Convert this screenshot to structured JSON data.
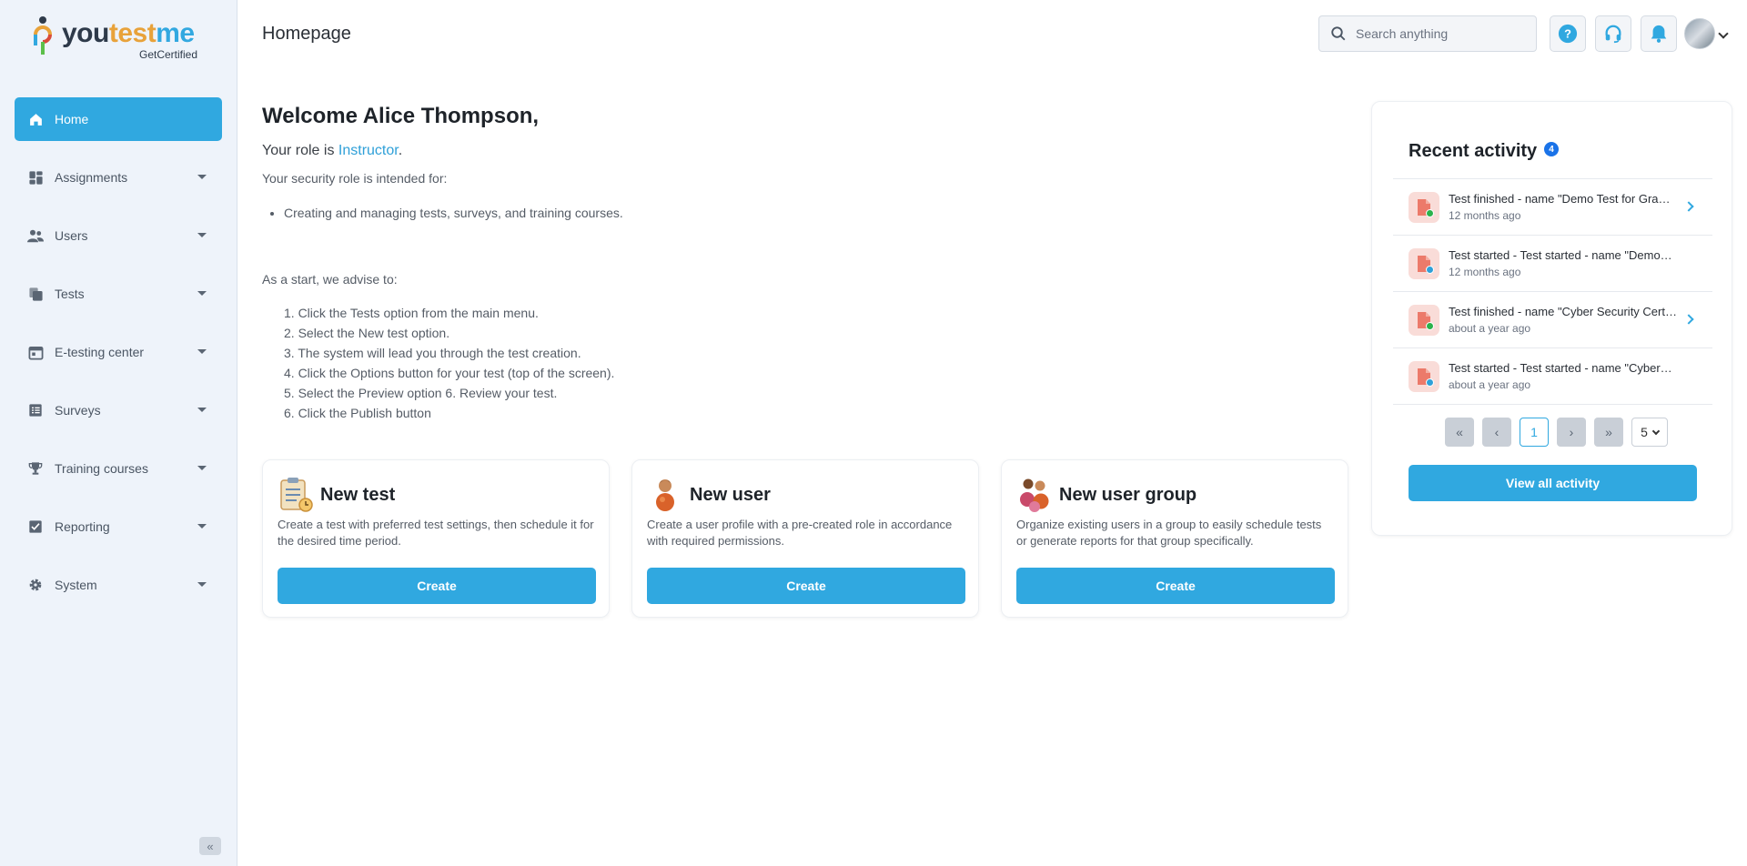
{
  "logo": {
    "brand": "youtestme",
    "tagline": "GetCertified"
  },
  "sidebar": {
    "items": [
      {
        "label": "Home",
        "icon": "home-icon",
        "active": true
      },
      {
        "label": "Assignments",
        "icon": "dashboard-icon"
      },
      {
        "label": "Users",
        "icon": "users-icon"
      },
      {
        "label": "Tests",
        "icon": "tests-icon"
      },
      {
        "label": "E-testing center",
        "icon": "calendar-icon"
      },
      {
        "label": "Surveys",
        "icon": "list-icon"
      },
      {
        "label": "Training courses",
        "icon": "trophy-icon"
      },
      {
        "label": "Reporting",
        "icon": "checkbox-icon"
      },
      {
        "label": "System",
        "icon": "gear-icon"
      }
    ],
    "collapse_label": "«"
  },
  "header": {
    "title": "Homepage",
    "search_placeholder": "Search anything"
  },
  "welcome": {
    "greeting": "Welcome Alice Thompson,",
    "role_prefix": "Your role is ",
    "role_name": "Instructor",
    "role_suffix": ".",
    "security_intro": "Your security role is intended for:",
    "security_items": [
      "Creating and managing tests, surveys, and training courses."
    ],
    "advise_intro": "As a start, we advise to:",
    "steps": [
      "1. Click the Tests option from the main menu.",
      "2. Select the New test option.",
      "3. The system will lead you through the test creation.",
      "4. Click the Options button for your test (top of the screen).",
      "5. Select the Preview option 6. Review your test.",
      "6. Click the Publish button"
    ]
  },
  "cards": [
    {
      "title": "New test",
      "description": "Create a test with preferred test settings, then schedule it for the desired time period.",
      "button": "Create"
    },
    {
      "title": "New user",
      "description": "Create a user profile with a pre-created role in accordance with required permissions.",
      "button": "Create"
    },
    {
      "title": "New user group",
      "description": "Organize existing users in a group to easily schedule tests or generate reports for that group specifically.",
      "button": "Create"
    }
  ],
  "recent_activity": {
    "title": "Recent activity",
    "count": "4",
    "items": [
      {
        "text": "Test finished - name \"Demo Test for Gra…",
        "time": "12 months ago",
        "status": "finished",
        "has_link": true
      },
      {
        "text": "Test started - Test started - name \"Demo…",
        "time": "12 months ago",
        "status": "started",
        "has_link": false
      },
      {
        "text": "Test finished - name \"Cyber Security Cert…",
        "time": "about a year ago",
        "status": "finished",
        "has_link": true
      },
      {
        "text": "Test started - Test started - name \"Cyber…",
        "time": "about a year ago",
        "status": "started",
        "has_link": false
      }
    ],
    "pager": {
      "first": "«",
      "prev": "‹",
      "current": "1",
      "next": "›",
      "last": "»",
      "page_size": "5"
    },
    "view_all": "View all activity"
  },
  "colors": {
    "accent": "#30a8e0",
    "sidebar_bg": "#eef3fa",
    "finished": "#2bb24c",
    "started": "#2fa0d8"
  }
}
